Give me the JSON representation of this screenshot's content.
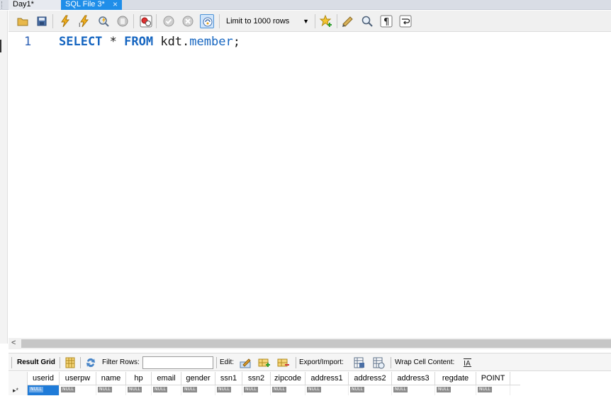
{
  "tabs": [
    {
      "label": "Day1*",
      "active": false
    },
    {
      "label": "SQL File 3*",
      "active": true
    }
  ],
  "toolbar": {
    "icons": [
      "open-folder-icon",
      "save-icon",
      "execute-icon",
      "execute-current-icon",
      "explain-icon",
      "stop-icon",
      "toggle-autocommit-icon",
      "commit-icon",
      "rollback-icon",
      "auto-commit-icon",
      "bookmark-star-icon",
      "beautify-icon",
      "find-icon",
      "invisible-chars-icon",
      "wrap-lines-icon"
    ],
    "limit_label": "Limit to 1000 rows"
  },
  "editor": {
    "line_number": "1",
    "tokens": [
      {
        "text": "SELECT",
        "kw": true
      },
      {
        "text": " * ",
        "kw": false
      },
      {
        "text": "FROM",
        "kw": true
      },
      {
        "text": " kdt.",
        "kw": false
      },
      {
        "text": "member",
        "kw": true
      },
      {
        "text": ";",
        "kw": false
      }
    ]
  },
  "result_toolbar": {
    "result_grid": "Result Grid",
    "filter_rows": "Filter Rows:",
    "filter_value": "",
    "edit": "Edit:",
    "export_import": "Export/Import:",
    "wrap_cell": "Wrap Cell Content:"
  },
  "grid": {
    "columns": [
      "userid",
      "userpw",
      "name",
      "hp",
      "email",
      "gender",
      "ssn1",
      "ssn2",
      "zipcode",
      "address1",
      "address2",
      "address3",
      "regdate",
      "POINT"
    ],
    "column_widths": [
      45,
      52,
      42,
      36,
      42,
      48,
      38,
      40,
      49,
      61,
      61,
      61,
      58,
      48
    ],
    "row_marker": "▸*",
    "null_text": "NULL"
  },
  "colors": {
    "active_tab": "#1f8ee9",
    "keyword": "#1565c0",
    "selected_cell": "#1f7bd8"
  }
}
